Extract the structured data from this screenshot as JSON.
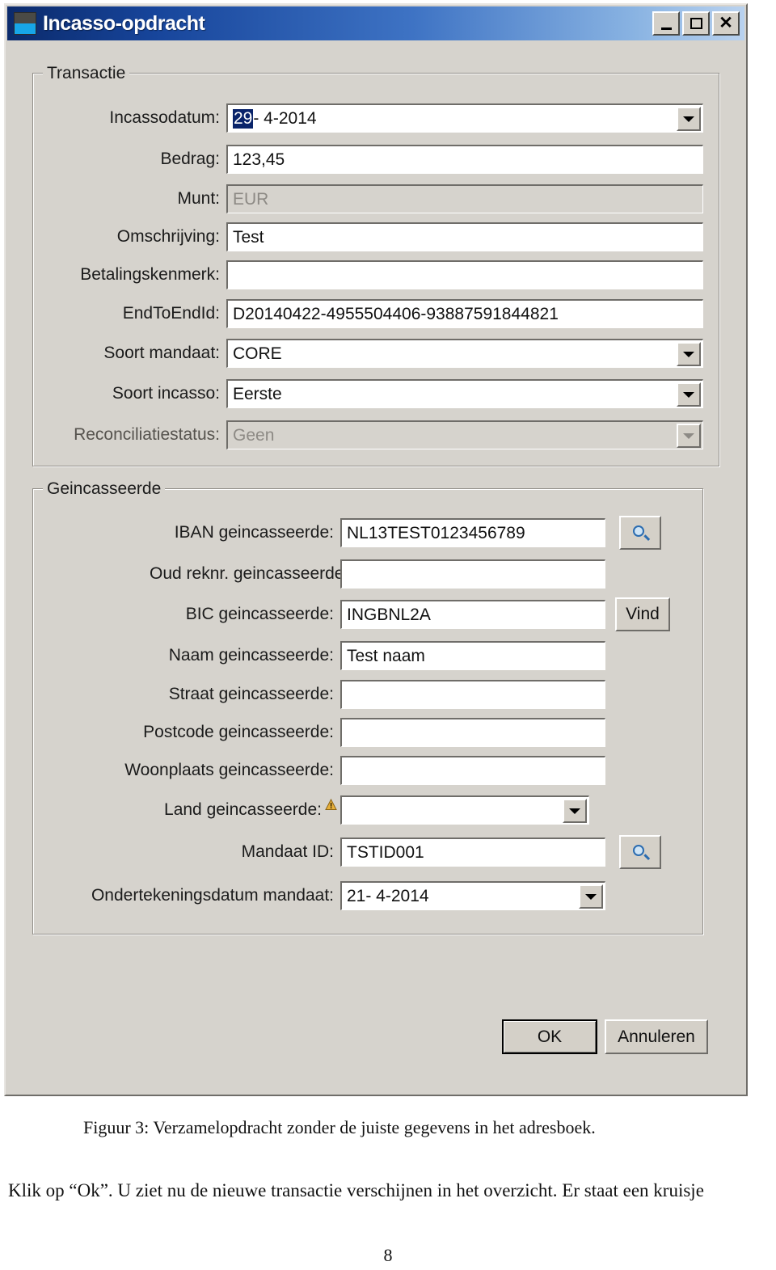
{
  "window": {
    "title": "Incasso-opdracht",
    "icon": "app-window-icon",
    "buttons": {
      "minimize": "_",
      "maximize": "□",
      "close": "✕"
    }
  },
  "transactie": {
    "legend": "Transactie",
    "fields": [
      {
        "label": "Incassodatum:",
        "value": "29-  4-2014",
        "selected_part": "29",
        "rest": "-  4-2014",
        "control": "combo",
        "disabled": false
      },
      {
        "label": "Bedrag:",
        "value": "123,45",
        "control": "textbox",
        "disabled": false
      },
      {
        "label": "Munt:",
        "value": "EUR",
        "control": "textbox",
        "disabled": true
      },
      {
        "label": "Omschrijving:",
        "value": "Test",
        "control": "textbox",
        "disabled": false
      },
      {
        "label": "Betalingskenmerk:",
        "value": "",
        "control": "textbox",
        "disabled": false
      },
      {
        "label": "EndToEndId:",
        "value": "D20140422-4955504406-93887591844821",
        "control": "textbox",
        "disabled": false
      },
      {
        "label": "Soort mandaat:",
        "value": "CORE",
        "control": "combo",
        "disabled": false
      },
      {
        "label": "Soort incasso:",
        "value": "Eerste",
        "control": "combo",
        "disabled": false
      },
      {
        "label": "Reconciliatiestatus:",
        "value": "Geen",
        "control": "combo",
        "disabled": true
      }
    ]
  },
  "geincasseerde": {
    "legend": "Geincasseerde",
    "fields": [
      {
        "label": "IBAN geincasseerde:",
        "value": "NL13TEST0123456789",
        "control": "textbox",
        "button": "search",
        "warn": false
      },
      {
        "label": "Oud reknr. geincasseerde:",
        "value": "",
        "control": "textbox",
        "button": "none",
        "warn": false
      },
      {
        "label": "BIC geincasseerde:",
        "value": "INGBNL2A",
        "control": "textbox",
        "button": "vind",
        "warn": false
      },
      {
        "label": "Naam geincasseerde:",
        "value": "Test naam",
        "control": "textbox",
        "button": "none",
        "warn": false
      },
      {
        "label": "Straat geincasseerde:",
        "value": "",
        "control": "textbox",
        "button": "none",
        "warn": false
      },
      {
        "label": "Postcode geincasseerde:",
        "value": "",
        "control": "textbox",
        "button": "none",
        "warn": false
      },
      {
        "label": "Woonplaats geincasseerde:",
        "value": "",
        "control": "textbox",
        "button": "none",
        "warn": false
      },
      {
        "label": "Land geincasseerde:",
        "value": "",
        "control": "combo",
        "button": "none",
        "warn": true
      },
      {
        "label": "Mandaat ID:",
        "value": "TSTID001",
        "control": "textbox",
        "button": "search",
        "warn": false
      },
      {
        "label": "Ondertekeningsdatum mandaat:",
        "value": "21-  4-2014",
        "control": "combo",
        "button": "none",
        "warn": false
      }
    ],
    "find_button_label": "Vind"
  },
  "dialog_buttons": {
    "ok": "OK",
    "cancel": "Annuleren"
  },
  "document": {
    "figure_caption": "Figuur 3: Verzamelopdracht zonder de juiste gegevens in het adresboek.",
    "paragraph": "Klik op “Ok”. U ziet nu de nieuwe transactie verschijnen in het overzicht. Er staat een kruisje",
    "page_number": "8"
  },
  "colors": {
    "title_bar_start": "#0b2a6b",
    "title_bar_end": "#b9d2ef",
    "dialog_face": "#d6d3cd",
    "selection": "#0a246a",
    "warning": "#e0a61f"
  }
}
